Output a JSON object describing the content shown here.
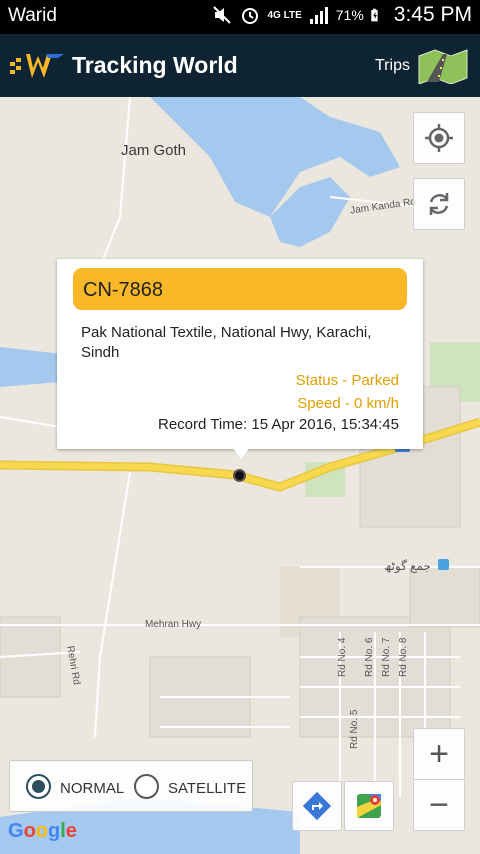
{
  "status_bar": {
    "carrier": "Warid",
    "battery": "71%",
    "network": "4G LTE",
    "time": "3:45 PM"
  },
  "app_bar": {
    "title": "Tracking World",
    "trips_label": "Trips"
  },
  "map": {
    "labels": {
      "jam_goth": "Jam Goth",
      "jam_kanda_rd": "Jam Kanda Rd",
      "urdu_place": "جمع گوٹھ",
      "mehran_hwy": "Mehran Hwy",
      "rehri_rd": "Rehri Rd",
      "rd_no_4": "Rd No. 4",
      "rd_no_6": "Rd No. 6",
      "rd_no_7": "Rd No. 7",
      "rd_no_8": "Rd No. 8",
      "rd_no_5": "Rd No. 5"
    },
    "attribution": "Google"
  },
  "popup": {
    "vehicle_id": "CN-7868",
    "address": "Pak National Textile,  National Hwy,  Karachi, Sindh",
    "status": "Status - Parked",
    "speed": "Speed - 0 km/h",
    "record_time": "Record Time: 15 Apr 2016, 15:34:45"
  },
  "map_type": {
    "options": [
      "NORMAL",
      "SATELLITE"
    ],
    "selected": "NORMAL"
  },
  "zoom": {
    "in": "+",
    "out": "−"
  },
  "colors": {
    "app_bar": "#0f2433",
    "header_accent": "#f9b828",
    "status_text": "#e0a000",
    "water": "#a4c8ee",
    "road_major": "#f7d84f"
  }
}
